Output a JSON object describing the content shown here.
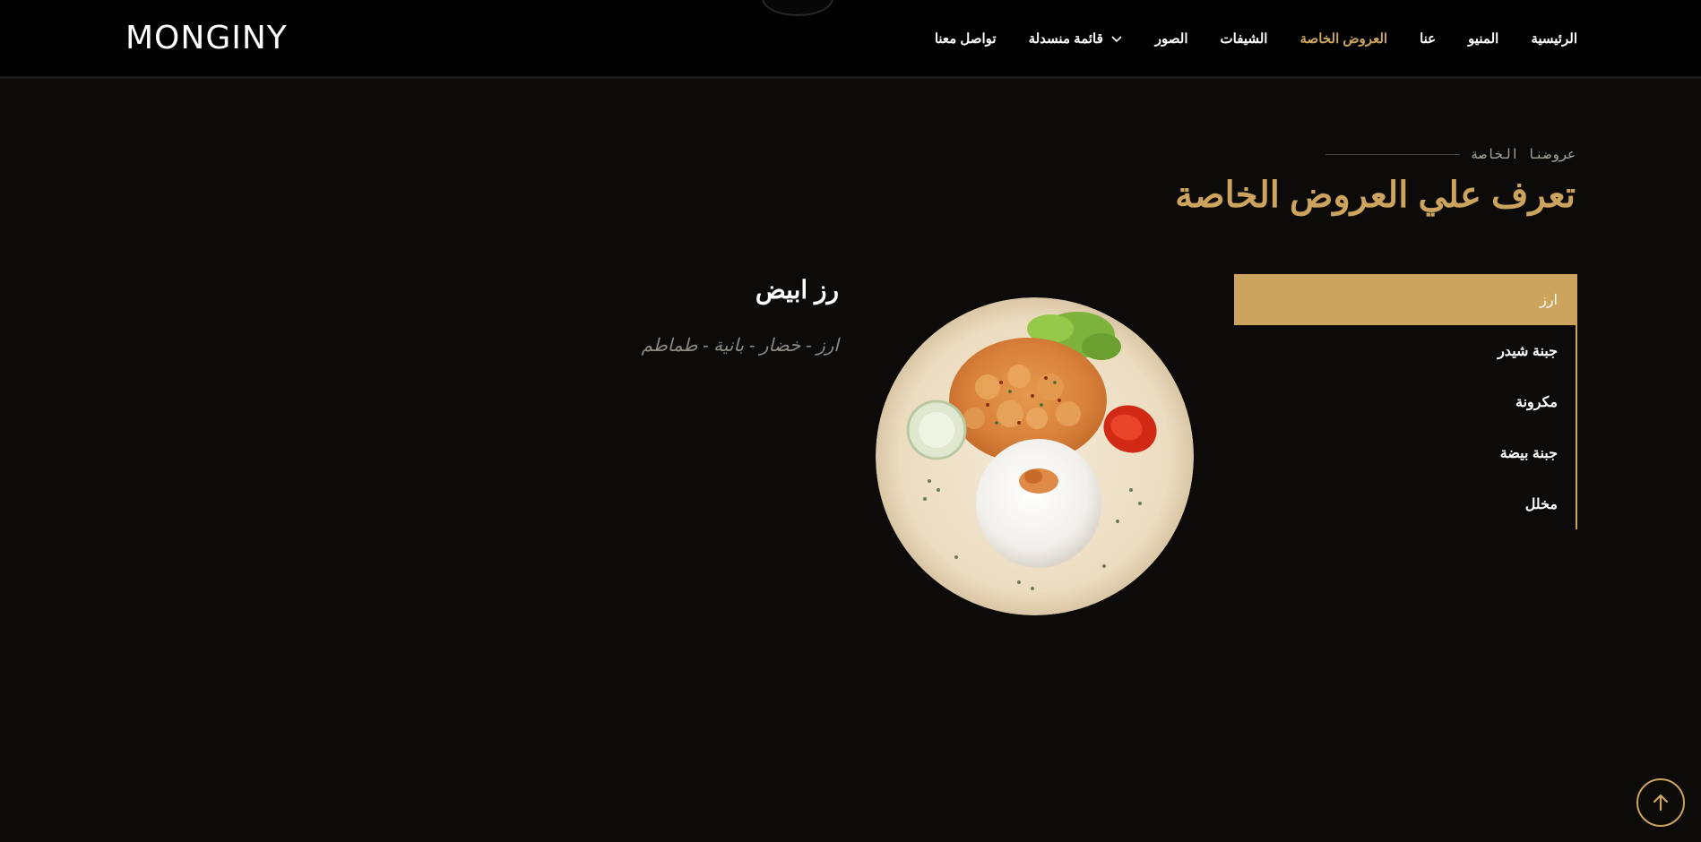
{
  "brand": {
    "logo": "MONGINY"
  },
  "nav": {
    "items": [
      {
        "label": "الرئيسية"
      },
      {
        "label": "المنيو"
      },
      {
        "label": "عنا"
      },
      {
        "label": "العروض الخاصة",
        "active": true
      },
      {
        "label": "الشيفات"
      },
      {
        "label": "الصور"
      },
      {
        "label": "قائمة منسدلة",
        "icon": "chevron-down-icon"
      },
      {
        "label": "تواصل معنا"
      }
    ]
  },
  "section": {
    "kicker": "عروضنا الخاصة",
    "title": "تعرف علي العروض الخاصة"
  },
  "specials": {
    "tabs": [
      {
        "label": "ارز",
        "active": true
      },
      {
        "label": "جبنة شيدر"
      },
      {
        "label": "مكرونة"
      },
      {
        "label": "جبنة بيضة"
      },
      {
        "label": "مخلل"
      }
    ],
    "selected": {
      "title": "رز ابيض",
      "description": "ارز - خضار - بانية - طماطم"
    }
  },
  "colors": {
    "accent": "#cda45e",
    "background": "#0c0b09",
    "header": "#000000"
  },
  "icons": {
    "back_to_top": "arrow-up-icon",
    "dropdown": "chevron-down-icon"
  }
}
